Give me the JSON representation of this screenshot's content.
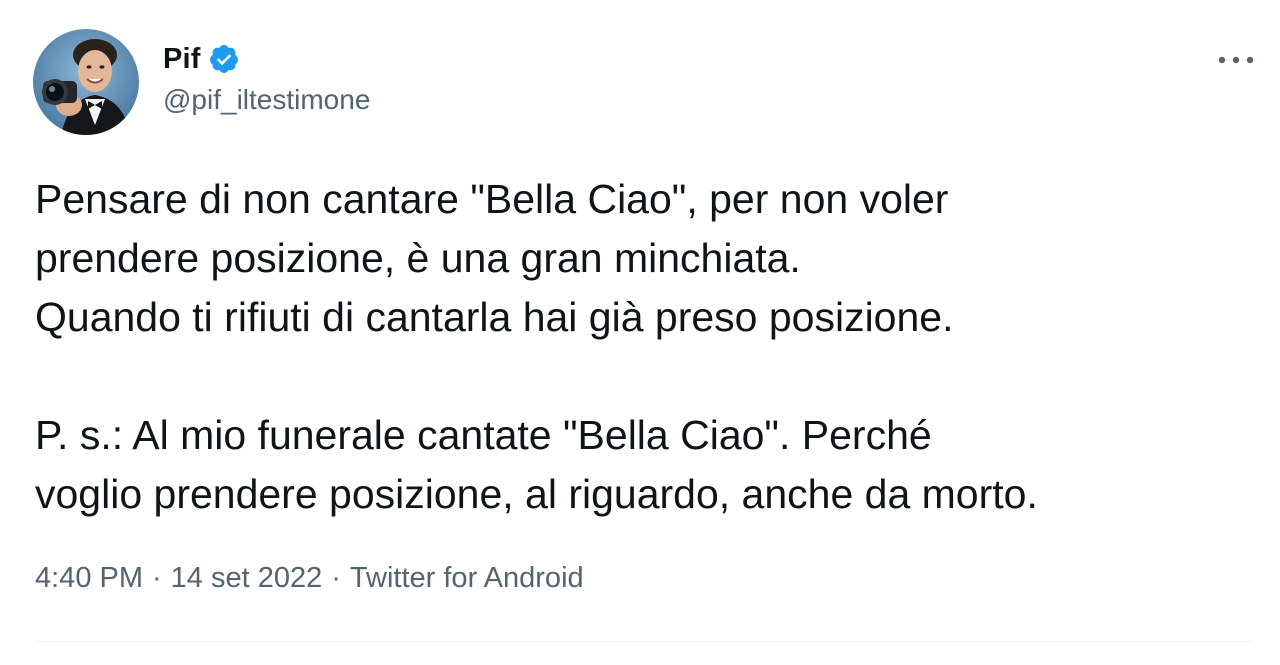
{
  "author": {
    "display_name": "Pif",
    "handle": "@pif_iltestimone",
    "verified": true,
    "avatar_icon": "avatar-photo"
  },
  "tweet": {
    "text": "Pensare di non cantare \"Bella Ciao\", per non voler\nprendere posizione, è una gran minchiata.\nQuando ti rifiuti di cantarla hai già preso posizione.\n\nP. s.: Al mio funerale cantate \"Bella Ciao\". Perché\nvoglio prendere posizione, al riguardo, anche da morto.",
    "time": "4:40 PM",
    "date": "14 set 2022",
    "source": "Twitter for Android",
    "separator": "·"
  },
  "icons": {
    "verified": "verified-badge-icon",
    "more": "more-options-icon"
  },
  "colors": {
    "text_primary": "#0f1419",
    "text_secondary": "#536471",
    "verified_blue": "#1d9bf0",
    "divider": "#eff3f4"
  }
}
